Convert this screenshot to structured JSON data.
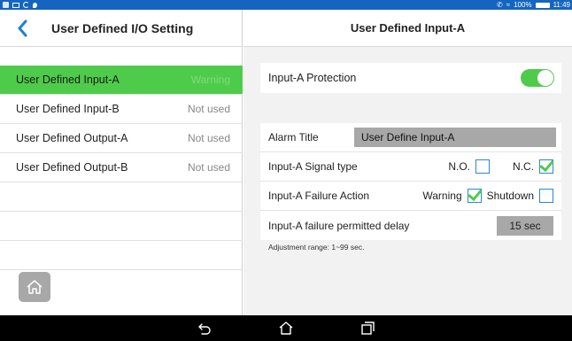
{
  "status_bar": {
    "battery": "100%",
    "time": "11:49"
  },
  "left": {
    "title": "User Defined I/O Setting",
    "items": [
      {
        "label": "User Defined Input-A",
        "status": "Warning",
        "active": true
      },
      {
        "label": "User Defined Input-B",
        "status": "Not used",
        "active": false
      },
      {
        "label": "User Defined Output-A",
        "status": "Not used",
        "active": false
      },
      {
        "label": "User Defined Output-B",
        "status": "Not used",
        "active": false
      }
    ]
  },
  "right": {
    "title": "User Defined Input-A",
    "protection": {
      "label": "Input-A Protection",
      "enabled": true
    },
    "alarm_title": {
      "label": "Alarm Title",
      "value": "User Define Input-A"
    },
    "signal_type": {
      "label": "Input-A Signal type",
      "no_label": "N.O.",
      "nc_label": "N.C.",
      "selected": "N.C."
    },
    "failure_action": {
      "label": "Input-A Failure Action",
      "warning_label": "Warning",
      "shutdown_label": "Shutdown",
      "selected": "Warning"
    },
    "delay": {
      "label": "Input-A failure permitted delay",
      "value": "15 sec"
    },
    "note": "Adjustment range: 1~99 sec."
  },
  "colors": {
    "accent_green": "#4fcb4c",
    "status_bar": "#1565c0",
    "checkbox_border": "#2a86d9",
    "field_gray": "#a8a8a8"
  }
}
